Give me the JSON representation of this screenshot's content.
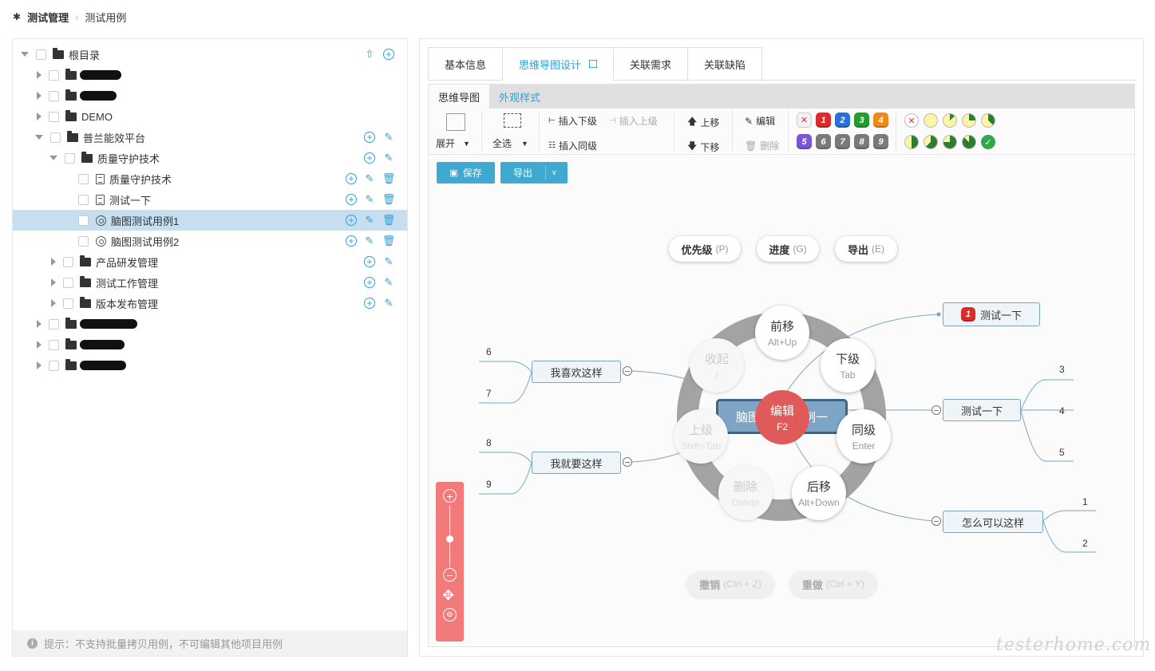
{
  "breadcrumb": {
    "root": "测试管理",
    "current": "测试用例"
  },
  "tree": {
    "root_label": "根目录",
    "items": {
      "demo": "DEMO",
      "platform": "普兰能效平台",
      "qa_tech": "质量守护技术",
      "qa_tech_case": "质量守护技术",
      "try_case": "测试一下",
      "mind1": "脑图测试用例1",
      "mind2": "脑图测试用例2",
      "rd": "产品研发管理",
      "testwork": "测试工作管理",
      "release": "版本发布管理"
    },
    "hint": "提示：不支持批量拷贝用例，不可编辑其他项目用例"
  },
  "tabs": [
    "基本信息",
    "思维导图设计",
    "关联需求",
    "关联缺陷"
  ],
  "subtabs": [
    "思维导图",
    "外观样式"
  ],
  "toolbar": {
    "expand": "展开",
    "select_all": "全选",
    "insert_child": "插入下级",
    "insert_parent": "插入上级",
    "insert_sibling": "插入同级",
    "move_up": "上移",
    "move_down": "下移",
    "edit": "编辑",
    "delete": "删除",
    "priorities": [
      "1",
      "2",
      "3",
      "4",
      "5",
      "6",
      "7",
      "8",
      "9"
    ],
    "priority_colors": {
      "1": "#e02a2a",
      "2": "#2d6fd8",
      "3": "#1f9e2d",
      "4": "#f08a16",
      "5": "#7b55d6",
      "6": "#7a7a7a",
      "7": "#7a7a7a",
      "8": "#7a7a7a",
      "9": "#7a7a7a"
    }
  },
  "buttons": {
    "save": "保存",
    "export": "导出"
  },
  "mindmap": {
    "hotkeys": {
      "priority": "优先级",
      "priority_key": "(P)",
      "progress": "进度",
      "progress_key": "(G)",
      "export": "导出",
      "export_key": "(E)",
      "undo": "撤销",
      "undo_key": "(Ctrl + Z)",
      "redo": "重做",
      "redo_key": "(Ctrl + Y)"
    },
    "root": {
      "left": "脑图",
      "right": "例一"
    },
    "menu": {
      "center": "编辑",
      "center_key": "F2",
      "prev": "前移",
      "prev_key": "Alt+Up",
      "child": "下级",
      "child_key": "Tab",
      "sibling": "同级",
      "sibling_key": "Enter",
      "next": "后移",
      "next_key": "Alt+Down",
      "delete": "删除",
      "delete_key": "Delete",
      "parent": "上级",
      "parent_key": "Shift+Tab",
      "collapse": "收起",
      "collapse_key": "/"
    },
    "nodes": {
      "like": "我喜欢这样",
      "want": "我就要这样",
      "test_top": "测试一下",
      "test_top_priority": "1",
      "test_mid": "测试一下",
      "how": "怎么可以这样"
    },
    "leaves": [
      "6",
      "7",
      "8",
      "9",
      "3",
      "4",
      "5",
      "1",
      "2"
    ]
  },
  "watermark": "testerhome.com"
}
